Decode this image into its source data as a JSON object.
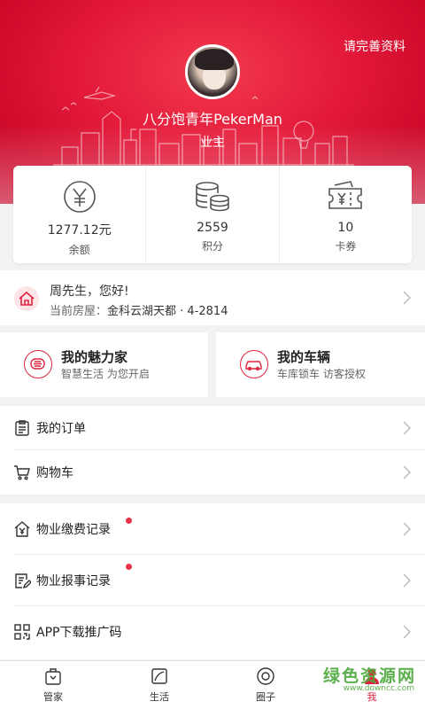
{
  "header": {
    "complete_profile": "请完善资料",
    "username": "八分饱青年PekerMan",
    "role": "业主"
  },
  "stats": [
    {
      "value": "1277.12元",
      "label": "余额",
      "icon": "yen-coin-icon"
    },
    {
      "value": "2559",
      "label": "积分",
      "icon": "coin-stack-icon"
    },
    {
      "value": "10",
      "label": "卡券",
      "icon": "coupon-ticket-icon"
    }
  ],
  "welcome": {
    "greeting": "周先生，您好!",
    "house_label": "当前房屋：",
    "house_value": "金科云湖天都 · 4-2814"
  },
  "cards": [
    {
      "title": "我的魅力家",
      "subtitle": "智慧生活 为您开启",
      "icon": "smart-home-icon"
    },
    {
      "title": "我的车辆",
      "subtitle": "车库锁车 访客授权",
      "icon": "car-icon"
    }
  ],
  "menu1": [
    {
      "label": "我的订单",
      "icon": "order-list-icon"
    },
    {
      "label": "购物车",
      "icon": "cart-icon"
    }
  ],
  "menu2": [
    {
      "label": "物业缴费记录",
      "icon": "payment-house-icon"
    },
    {
      "label": "物业报事记录",
      "icon": "report-doc-icon"
    },
    {
      "label": "APP下载推广码",
      "icon": "qrcode-icon"
    }
  ],
  "tabs": [
    {
      "label": "管家",
      "icon": "butler-icon"
    },
    {
      "label": "生活",
      "icon": "life-icon"
    },
    {
      "label": "圈子",
      "icon": "circle-icon"
    },
    {
      "label": "我",
      "icon": "me-icon"
    }
  ],
  "watermark": {
    "cn": "绿色资源网",
    "url": "www.downcc.com"
  },
  "colors": {
    "brand": "#e0243f",
    "header": "#e3193a",
    "badge": "#e8334a"
  }
}
